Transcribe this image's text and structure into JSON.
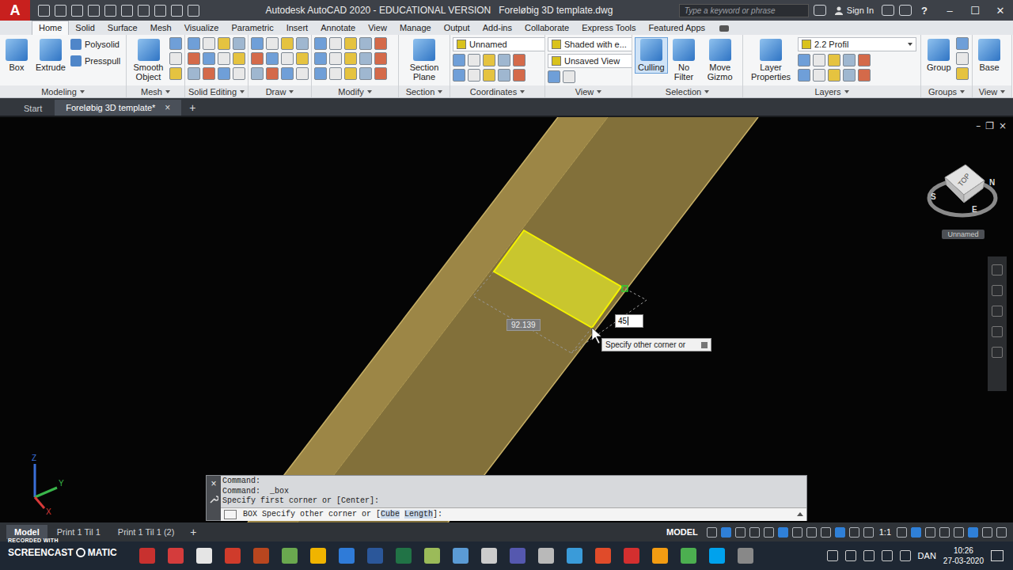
{
  "title_bar": {
    "logo": "A",
    "title": "Autodesk AutoCAD 2020 - EDUCATIONAL VERSION   Foreløbig 3D template.dwg",
    "search": {
      "placeholder": "Type a keyword or phrase"
    },
    "sign_in": "Sign In",
    "help": "?",
    "window_controls": [
      "–",
      "☐",
      "✕"
    ]
  },
  "ribbon": {
    "tabs": [
      {
        "label": "Home",
        "selected": true
      },
      {
        "label": "Solid",
        "selected": false
      },
      {
        "label": "Surface",
        "selected": false
      },
      {
        "label": "Mesh",
        "selected": false
      },
      {
        "label": "Visualize",
        "selected": false
      },
      {
        "label": "Parametric",
        "selected": false
      },
      {
        "label": "Insert",
        "selected": false
      },
      {
        "label": "Annotate",
        "selected": false
      },
      {
        "label": "View",
        "selected": false
      },
      {
        "label": "Manage",
        "selected": false
      },
      {
        "label": "Output",
        "selected": false
      },
      {
        "label": "Add-ins",
        "selected": false
      },
      {
        "label": "Collaborate",
        "selected": false
      },
      {
        "label": "Express Tools",
        "selected": false
      },
      {
        "label": "Featured Apps",
        "selected": false
      }
    ],
    "panels": [
      {
        "label": "Modeling",
        "items": [
          {
            "kind": "large",
            "label": "Box",
            "active": false
          },
          {
            "kind": "large",
            "label": "Extrude",
            "active": false
          },
          {
            "kind": "small",
            "label": "Polysolid",
            "active": false
          },
          {
            "kind": "small",
            "label": "Presspull",
            "active": false
          }
        ]
      },
      {
        "label": "Mesh",
        "items": [
          {
            "kind": "large",
            "label": "Smooth Object",
            "active": false
          }
        ]
      },
      {
        "label": "Solid Editing",
        "items": []
      },
      {
        "label": "Draw",
        "items": []
      },
      {
        "label": "Modify",
        "items": []
      },
      {
        "label": "Section",
        "items": [
          {
            "kind": "large",
            "label": "Section Plane",
            "active": false
          }
        ]
      },
      {
        "label": "Coordinates",
        "items": [
          {
            "kind": "dropdown",
            "label": "Unnamed",
            "active": false
          }
        ]
      },
      {
        "label": "View",
        "items": [
          {
            "kind": "dropdown",
            "label": "Shaded with e...",
            "active": false
          },
          {
            "kind": "dropdown",
            "label": "Unsaved View",
            "active": false
          }
        ]
      },
      {
        "label": "Selection",
        "items": [
          {
            "kind": "large",
            "label": "Culling",
            "active": true
          },
          {
            "kind": "large",
            "label": "No Filter",
            "active": false
          },
          {
            "kind": "large",
            "label": "Move Gizmo",
            "active": false
          }
        ]
      },
      {
        "label": "Layers",
        "items": [
          {
            "kind": "large",
            "label": "Layer Properties",
            "active": false
          },
          {
            "kind": "dropdown",
            "label": "2.2 Profil",
            "active": false
          }
        ]
      },
      {
        "label": "Groups",
        "items": [
          {
            "kind": "large",
            "label": "Group",
            "active": false
          }
        ]
      },
      {
        "label": "View",
        "items": [
          {
            "kind": "large",
            "label": "Base",
            "active": false
          }
        ]
      }
    ]
  },
  "document_tabs": {
    "tabs": [
      {
        "label": "Start",
        "selected": false,
        "closable": false
      },
      {
        "label": "Foreløbig 3D template*",
        "selected": true,
        "closable": true
      }
    ],
    "close": "×",
    "add": "+"
  },
  "viewport": {
    "controls": [
      "–",
      "❐",
      "×"
    ],
    "view_cube": {
      "face": "TOP",
      "compass": [
        "S",
        "E",
        "N"
      ],
      "view_name": "Unnamed"
    },
    "ucs": {
      "axes": [
        "Z",
        "Y",
        "X"
      ]
    },
    "dynamic_input": {
      "dimension": "92.139",
      "value": "45",
      "tooltip": "Specify other corner or"
    }
  },
  "command_line": {
    "close": "×",
    "history": [
      "Command:",
      "Command:  _box",
      "Specify first corner or [Center]:"
    ],
    "prompt": {
      "command": "BOX",
      "text": "Specify other corner or [",
      "options": [
        "Cube",
        "Length"
      ],
      "end": "]:"
    }
  },
  "layout_tabs": {
    "tabs": [
      {
        "label": "Model",
        "selected": true
      },
      {
        "label": "Print 1 Til 1",
        "selected": false
      },
      {
        "label": "Print 1 Til 1 (2)",
        "selected": false
      }
    ],
    "add": "+"
  },
  "status_bar": {
    "space": "MODEL",
    "scale": "1:1"
  },
  "taskbar": {
    "language": "DAN",
    "time": "10:26",
    "date": "27-03-2020"
  },
  "watermark": {
    "line1": "RECORDED WITH",
    "brand": "SCREENCAST",
    "brand2": "MATIC"
  }
}
